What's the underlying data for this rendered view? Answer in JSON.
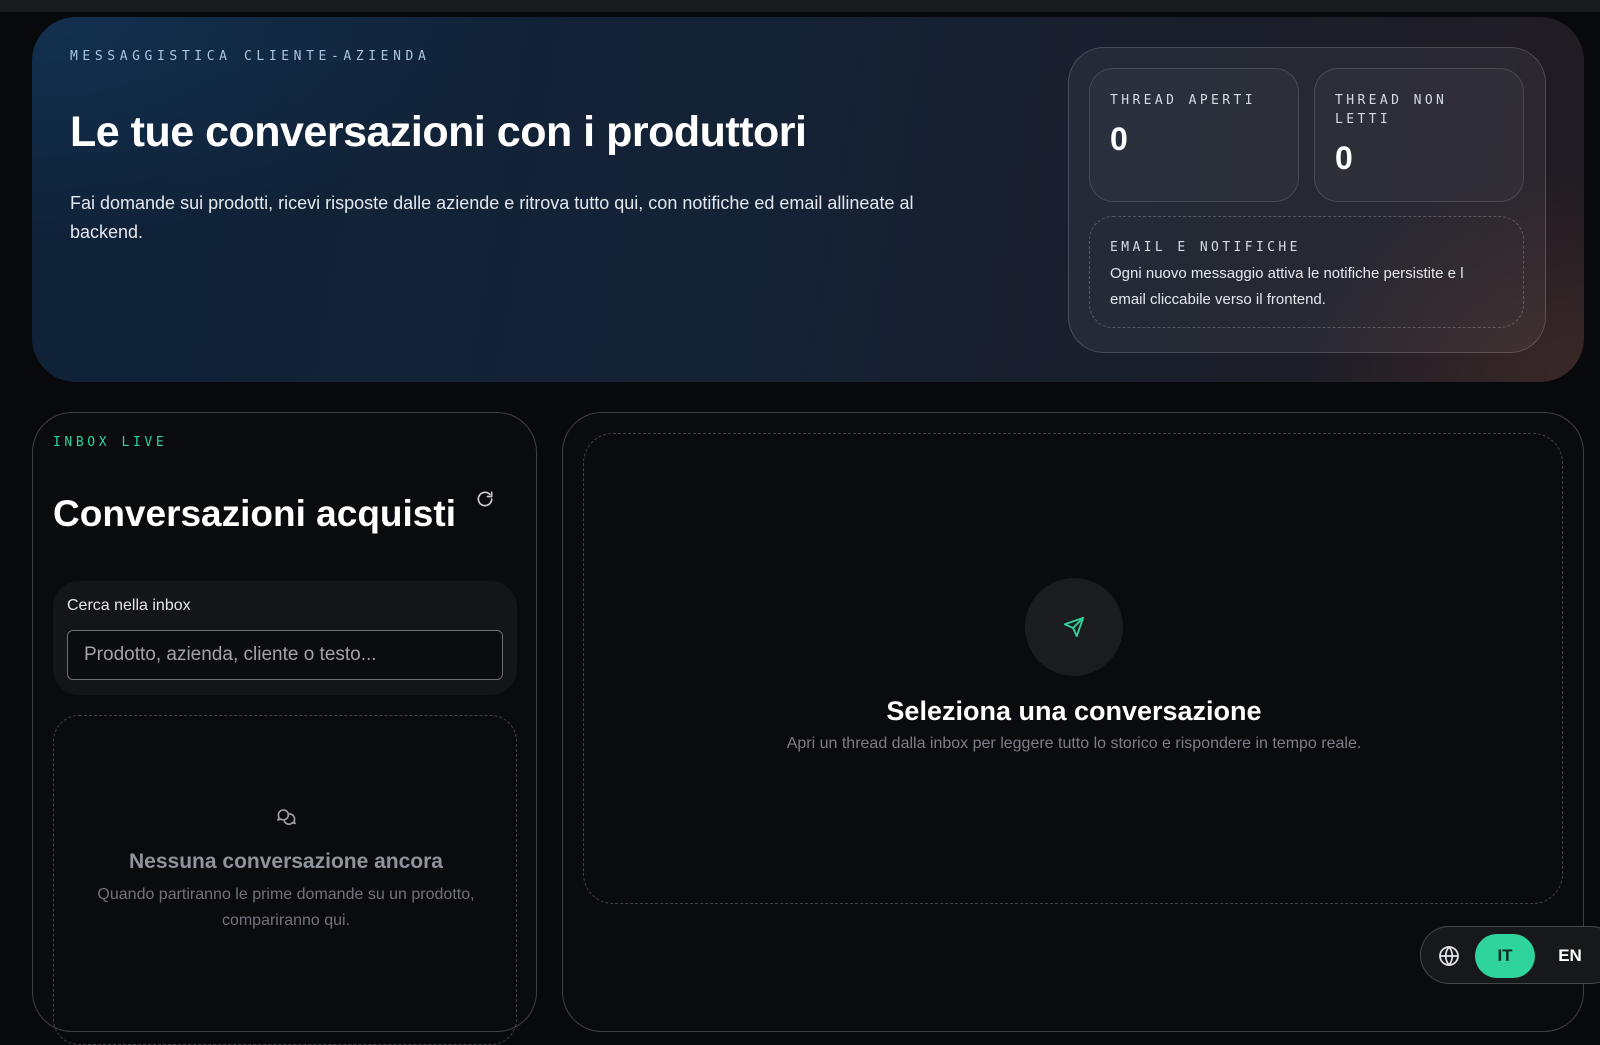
{
  "hero": {
    "eyebrow": "MESSAGGISTICA CLIENTE-AZIENDA",
    "title": "Le tue conversazioni con i produttori",
    "description": "Fai domande sui prodotti, ricevi risposte dalle aziende e ritrova tutto qui, con notifiche ed email allineate al backend.",
    "stats": [
      {
        "label": "THREAD APERTI",
        "value": "0"
      },
      {
        "label": "THREAD NON LETTI",
        "value": "0"
      }
    ],
    "notice": {
      "label": "EMAIL E NOTIFICHE",
      "text": "Ogni nuovo messaggio attiva le notifiche persistite e l email cliccabile verso il frontend."
    }
  },
  "inbox": {
    "eyebrow": "INBOX LIVE",
    "title": "Conversazioni acquisti",
    "refresh_icon": "refresh-icon",
    "search": {
      "label": "Cerca nella inbox",
      "value": "",
      "placeholder": "Prodotto, azienda, cliente o testo..."
    },
    "empty": {
      "icon": "chat-bubbles-icon",
      "title": "Nessuna conversazione ancora",
      "text": "Quando partiranno le prime domande su un prodotto, compariranno qui."
    }
  },
  "thread": {
    "icon": "send-icon",
    "title": "Seleziona una conversazione",
    "text": "Apri un thread dalla inbox per leggere tutto lo storico e rispondere in tempo reale."
  },
  "language": {
    "icon": "globe-icon",
    "options": [
      "IT",
      "EN"
    ],
    "selected": "IT"
  },
  "colors": {
    "accent": "#2fd49c",
    "background": "#08090c",
    "panel_border": "#3a3b3f"
  }
}
